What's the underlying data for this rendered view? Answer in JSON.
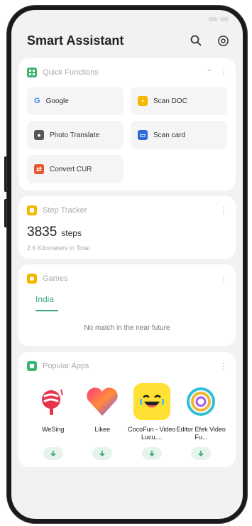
{
  "header": {
    "title": "Smart Assistant",
    "search_icon": "search-icon",
    "settings_icon": "settings-icon"
  },
  "quick_functions": {
    "title": "Quick Functions",
    "items": [
      {
        "label": "Google",
        "icon": "google-icon",
        "color": "#4285F4"
      },
      {
        "label": "Scan DOC",
        "icon": "scan-doc-icon",
        "color": "#F5B700"
      },
      {
        "label": "Photo Translate",
        "icon": "photo-translate-icon",
        "color": "#555555"
      },
      {
        "label": "Scan card",
        "icon": "scan-card-icon",
        "color": "#2D6BD6"
      },
      {
        "label": "Convert CUR",
        "icon": "convert-currency-icon",
        "color": "#E8542B"
      }
    ]
  },
  "step_tracker": {
    "title": "Step Tracker",
    "count": "3835",
    "unit": "steps",
    "subtitle": "2.6 Kilometers in Total"
  },
  "games": {
    "title": "Games",
    "tab": "India",
    "empty_message": "No match in the near future"
  },
  "popular_apps": {
    "title": "Popular Apps",
    "apps": [
      {
        "name": "WeSing",
        "icon": "wesing-icon"
      },
      {
        "name": "Likee",
        "icon": "likee-icon"
      },
      {
        "name": "CocoFun - Video Lucu,...",
        "icon": "cocofun-icon"
      },
      {
        "name": "Editor Efek Video Fu...",
        "icon": "editor-icon"
      }
    ]
  },
  "colors": {
    "accent_green": "#3aa57a",
    "quick_functions_icon": "#3bb56f",
    "step_tracker_icon": "#f5b700",
    "games_icon": "#f5b700",
    "popular_apps_icon": "#3bb56f"
  }
}
